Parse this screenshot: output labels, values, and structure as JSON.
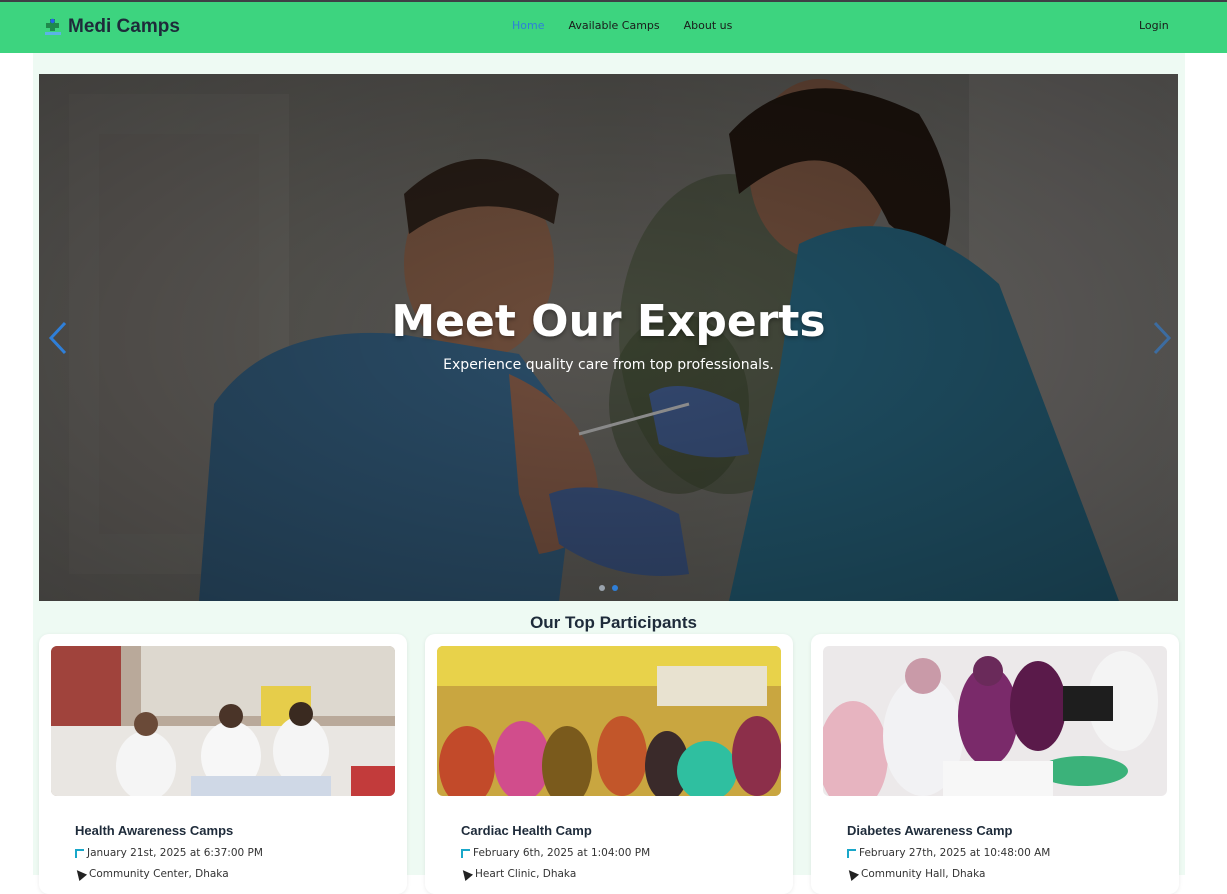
{
  "brand": {
    "name": "Medi Camps",
    "logo_icon": "medical-logo-icon"
  },
  "nav": {
    "links": [
      {
        "label": "Home",
        "active": true
      },
      {
        "label": "Available Camps",
        "active": false
      },
      {
        "label": "About us",
        "active": false
      }
    ],
    "login_label": "Login"
  },
  "hero": {
    "title": "Meet Our Experts",
    "subtitle": "Experience quality care from top professionals.",
    "prev_icon": "chevron-left-icon",
    "next_icon": "chevron-right-icon",
    "slide_count": 2,
    "active_slide": 2
  },
  "participants": {
    "heading": "Our Top Participants",
    "cards": [
      {
        "title": "Health Awareness Camps",
        "date": "January 21st, 2025 at 6:37:00 PM",
        "location": "Community Center, Dhaka"
      },
      {
        "title": "Cardiac Health Camp",
        "date": "February 6th, 2025 at 1:04:00 PM",
        "location": "Heart Clinic, Dhaka"
      },
      {
        "title": "Diabetes Awareness Camp",
        "date": "February 27th, 2025 at 10:48:00 AM",
        "location": "Community Hall, Dhaka"
      }
    ]
  },
  "colors": {
    "nav_bg": "#3dd47f",
    "active_link": "#2f7fd8",
    "page_bg": "#eefaf3",
    "heading": "#1e2b3a"
  }
}
